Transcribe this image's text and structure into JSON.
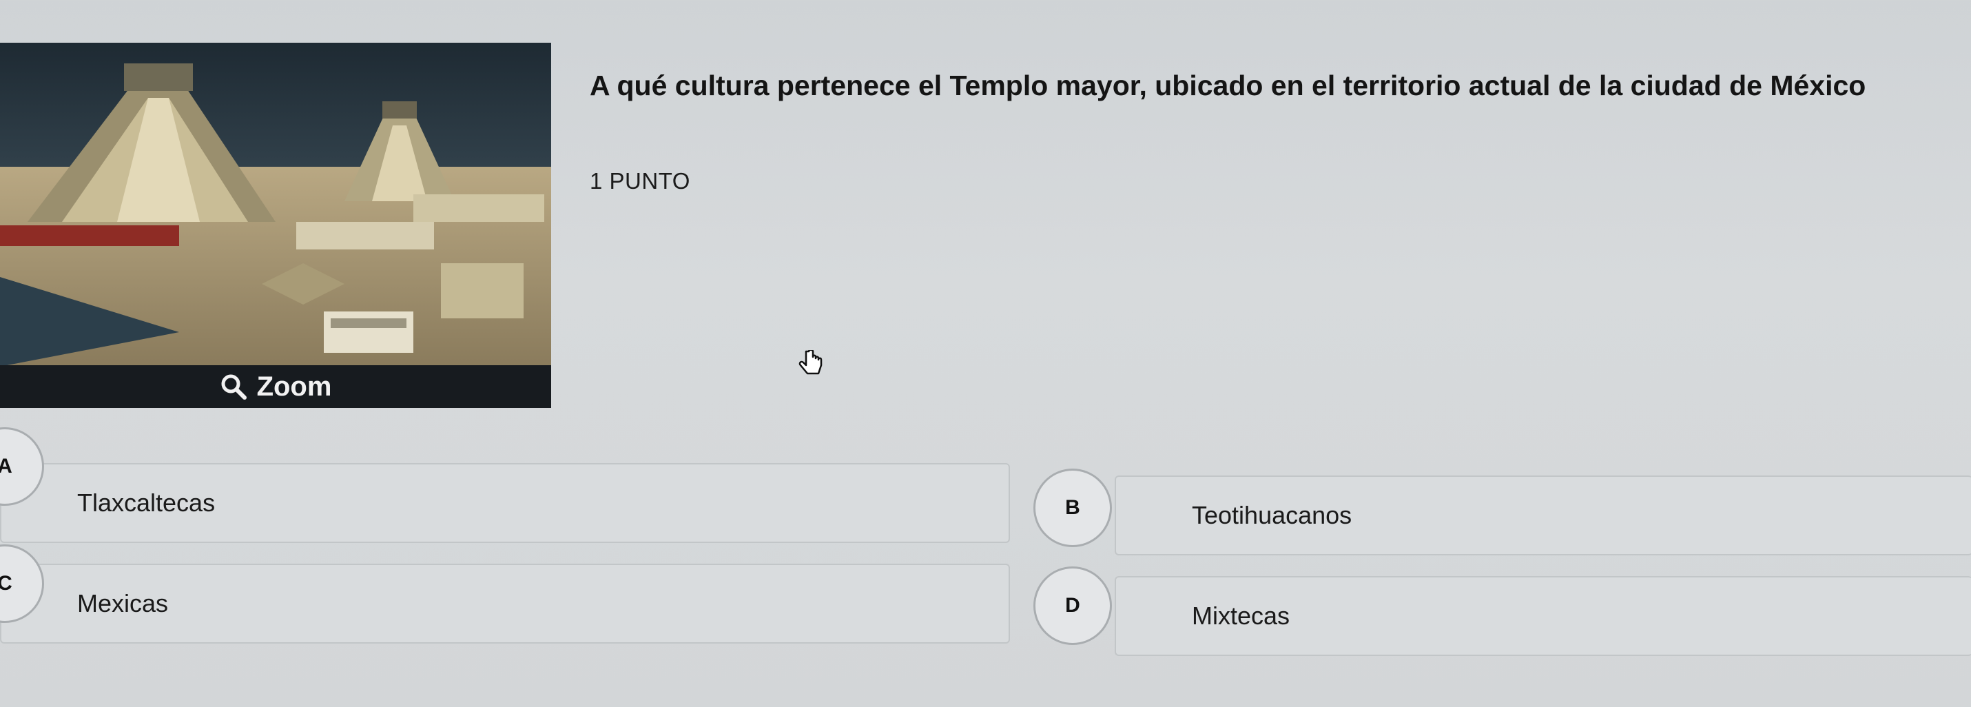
{
  "image": {
    "zoom_label": "Zoom",
    "zoom_icon": "search-icon"
  },
  "question": {
    "text": "A qué cultura pertenece el Templo mayor, ubicado en el territorio actual de la ciudad de México",
    "points": "1 PUNTO"
  },
  "options": [
    {
      "letter": "A",
      "label": "Tlaxcaltecas"
    },
    {
      "letter": "B",
      "label": "Teotihuacanos"
    },
    {
      "letter": "C",
      "label": "Mexicas"
    },
    {
      "letter": "D",
      "label": "Mixtecas"
    }
  ],
  "colors": {
    "background": "#d3d6d8",
    "zoom_bar": "#171b1f",
    "option_border": "#c2c6c8"
  }
}
